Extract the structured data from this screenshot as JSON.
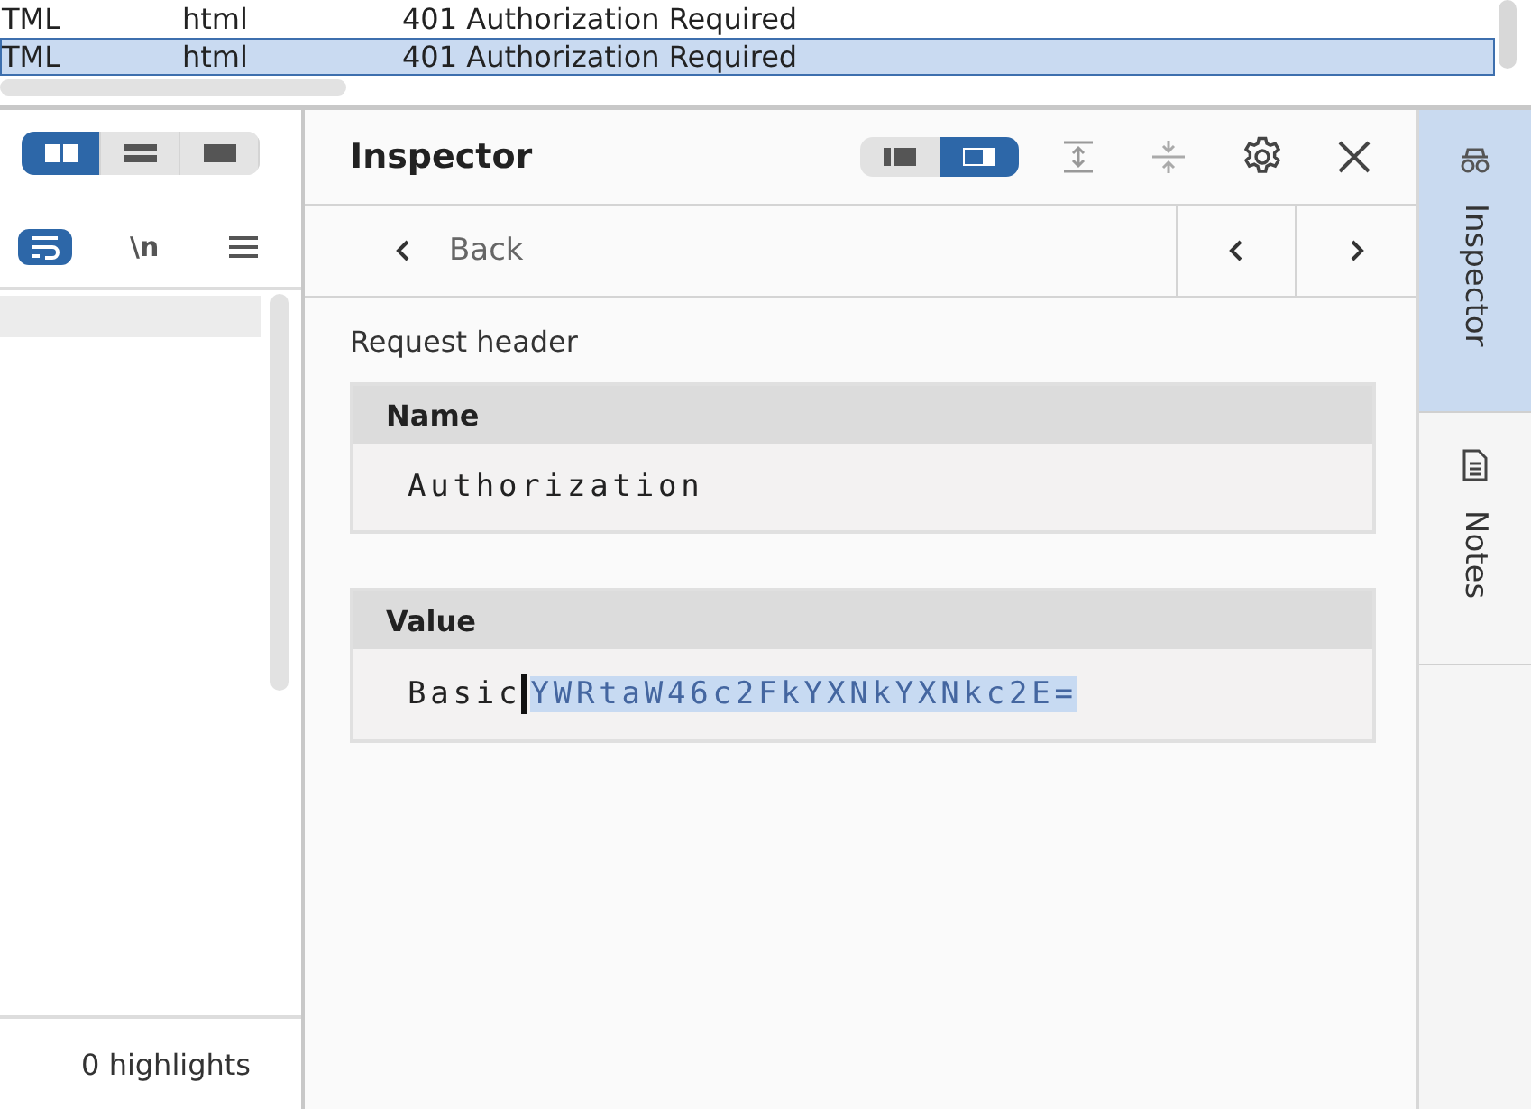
{
  "request_table": {
    "rows": [
      {
        "cells": [
          "TML",
          "html",
          "401 Authorization Required"
        ],
        "selected": false
      },
      {
        "cells": [
          "TML",
          "html",
          "401 Authorization Required"
        ],
        "selected": true
      }
    ]
  },
  "message_panel": {
    "layout_options": [
      {
        "kind": "split",
        "selected": true
      },
      {
        "kind": "stacked",
        "selected": false
      },
      {
        "kind": "single",
        "selected": false
      }
    ],
    "editor_options": [
      {
        "kind": "wrap",
        "selected": true
      },
      {
        "kind": "text",
        "label": "\\n",
        "selected": false
      },
      {
        "kind": "menu",
        "selected": false
      }
    ],
    "highlights": "0 highlights"
  },
  "inspector": {
    "title": "Inspector",
    "layout_options": [
      {
        "kind": "left",
        "selected": false
      },
      {
        "kind": "right",
        "selected": true
      }
    ],
    "back": "Back",
    "section": "Request header",
    "fields": [
      {
        "label": "Name",
        "value": "Authorization"
      },
      {
        "label": "Value",
        "value": "Basic",
        "selection": "YWRtaW46c2FkYXNkYXNkc2E="
      }
    ]
  },
  "side_tabs": [
    {
      "kind": "inspector",
      "label": "Inspector",
      "selected": true
    },
    {
      "kind": "notes",
      "label": "Notes",
      "selected": false
    }
  ]
}
